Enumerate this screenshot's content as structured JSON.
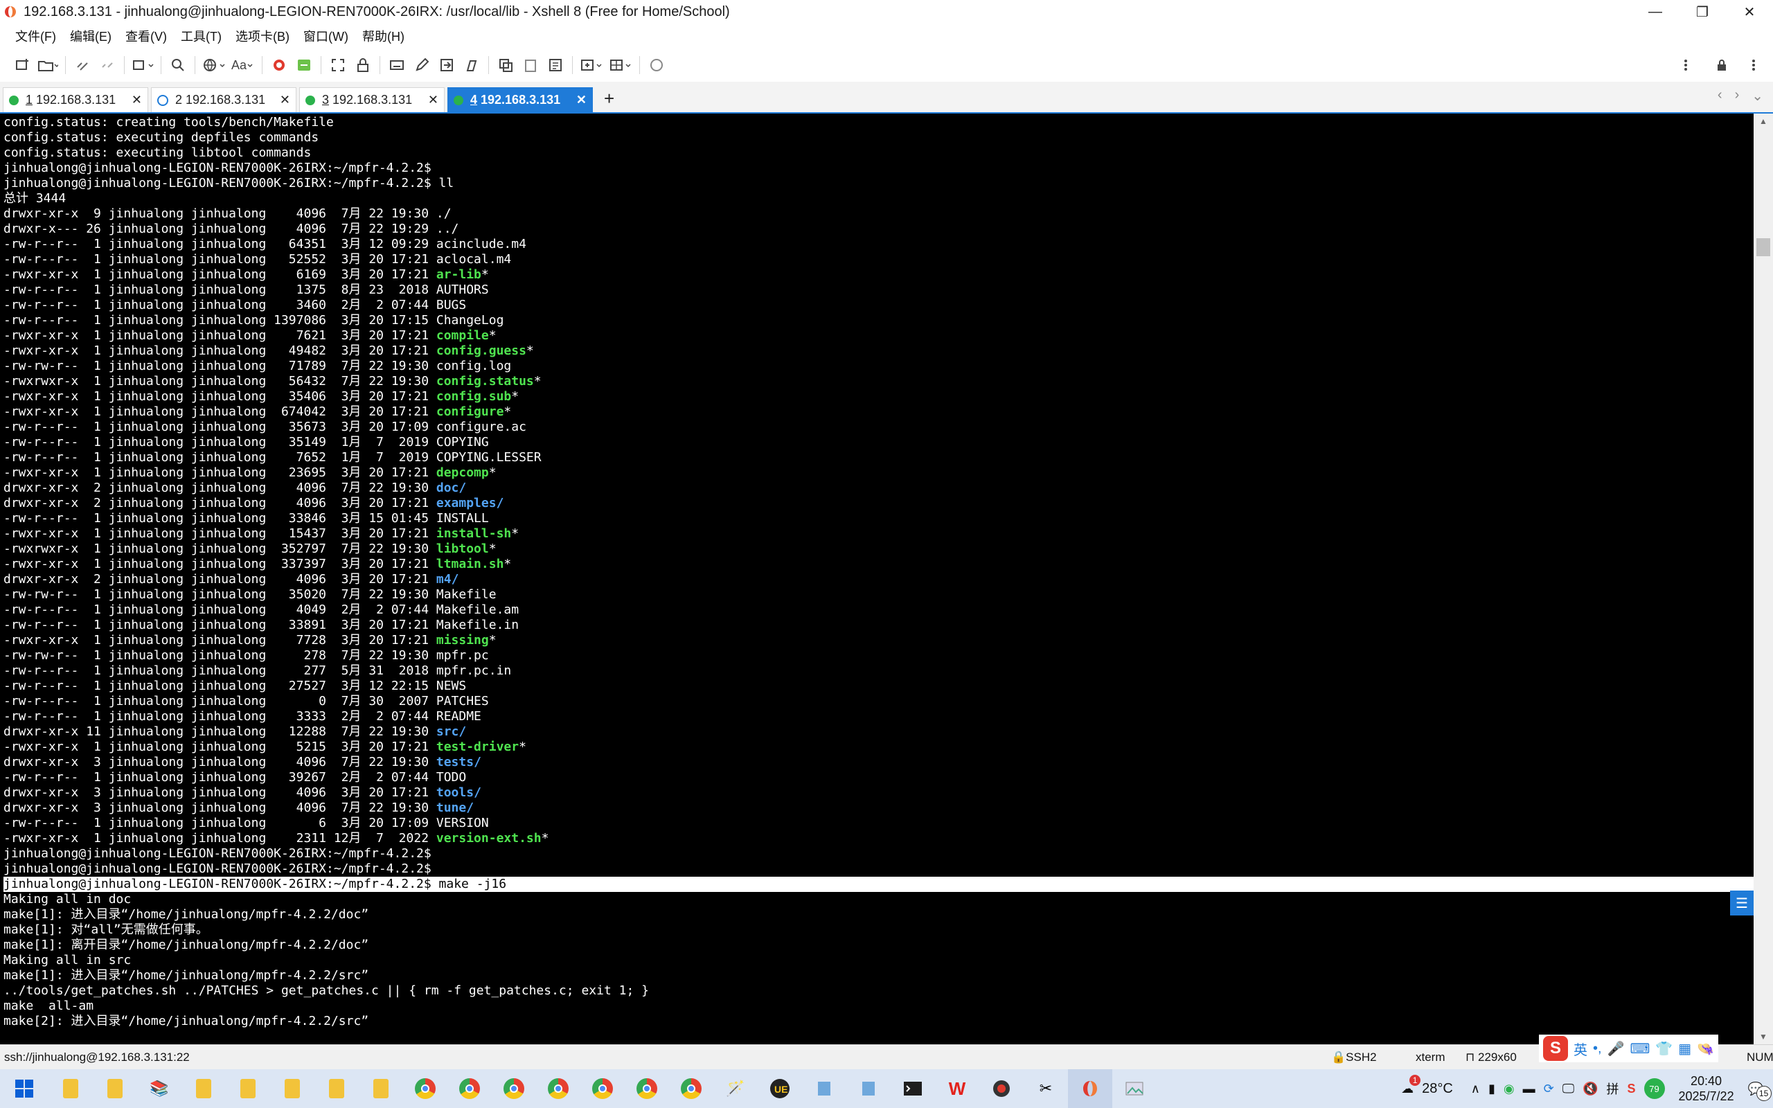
{
  "window": {
    "title": "192.168.3.131 - jinhualong@jinhualong-LEGION-REN7000K-26IRX: /usr/local/lib - Xshell 8 (Free for Home/School)",
    "minimize": "—",
    "maximize": "❐",
    "close": "✕"
  },
  "menu": [
    "文件(F)",
    "编辑(E)",
    "查看(V)",
    "工具(T)",
    "选项卡(B)",
    "窗口(W)",
    "帮助(H)"
  ],
  "tabs": [
    {
      "num": "1",
      "label": " 192.168.3.131",
      "status": "green",
      "close": "✕"
    },
    {
      "num": "2",
      "label": " 192.168.3.131",
      "status": "warning",
      "close": "✕"
    },
    {
      "num": "3",
      "label": " 192.168.3.131",
      "status": "green",
      "close": "✕"
    },
    {
      "num": "4",
      "label": " 192.168.3.131",
      "status": "green",
      "close": "✕",
      "active": true
    }
  ],
  "terminal": {
    "lines": [
      {
        "text": "config.status: creating tools/bench/Makefile"
      },
      {
        "text": "config.status: executing depfiles commands"
      },
      {
        "text": "config.status: executing libtool commands"
      },
      {
        "text": "jinhualong@jinhualong-LEGION-REN7000K-26IRX:~/mpfr-4.2.2$"
      },
      {
        "text": "jinhualong@jinhualong-LEGION-REN7000K-26IRX:~/mpfr-4.2.2$ ll"
      },
      {
        "text": "总计 3444"
      },
      {
        "prefix": "drwxr-xr-x  9 jinhualong jinhualong    4096  7月 22 19:30 ",
        "name": "./",
        "color": "plain"
      },
      {
        "prefix": "drwxr-x--- 26 jinhualong jinhualong    4096  7月 22 19:29 ",
        "name": "../",
        "color": "plain"
      },
      {
        "prefix": "-rw-r--r--  1 jinhualong jinhualong   64351  3月 12 09:29 ",
        "name": "acinclude.m4",
        "color": "plain"
      },
      {
        "prefix": "-rw-r--r--  1 jinhualong jinhualong   52552  3月 20 17:21 ",
        "name": "aclocal.m4",
        "color": "plain"
      },
      {
        "prefix": "-rwxr-xr-x  1 jinhualong jinhualong    6169  3月 20 17:21 ",
        "name": "ar-lib",
        "suffix": "*",
        "color": "green"
      },
      {
        "prefix": "-rw-r--r--  1 jinhualong jinhualong    1375  8月 23  2018 ",
        "name": "AUTHORS",
        "color": "plain"
      },
      {
        "prefix": "-rw-r--r--  1 jinhualong jinhualong    3460  2月  2 07:44 ",
        "name": "BUGS",
        "color": "plain"
      },
      {
        "prefix": "-rw-r--r--  1 jinhualong jinhualong 1397086  3月 20 17:15 ",
        "name": "ChangeLog",
        "color": "plain"
      },
      {
        "prefix": "-rwxr-xr-x  1 jinhualong jinhualong    7621  3月 20 17:21 ",
        "name": "compile",
        "suffix": "*",
        "color": "green"
      },
      {
        "prefix": "-rwxr-xr-x  1 jinhualong jinhualong   49482  3月 20 17:21 ",
        "name": "config.guess",
        "suffix": "*",
        "color": "green"
      },
      {
        "prefix": "-rw-rw-r--  1 jinhualong jinhualong   71789  7月 22 19:30 ",
        "name": "config.log",
        "color": "plain"
      },
      {
        "prefix": "-rwxrwxr-x  1 jinhualong jinhualong   56432  7月 22 19:30 ",
        "name": "config.status",
        "suffix": "*",
        "color": "green"
      },
      {
        "prefix": "-rwxr-xr-x  1 jinhualong jinhualong   35406  3月 20 17:21 ",
        "name": "config.sub",
        "suffix": "*",
        "color": "green"
      },
      {
        "prefix": "-rwxr-xr-x  1 jinhualong jinhualong  674042  3月 20 17:21 ",
        "name": "configure",
        "suffix": "*",
        "color": "green"
      },
      {
        "prefix": "-rw-r--r--  1 jinhualong jinhualong   35673  3月 20 17:09 ",
        "name": "configure.ac",
        "color": "plain"
      },
      {
        "prefix": "-rw-r--r--  1 jinhualong jinhualong   35149  1月  7  2019 ",
        "name": "COPYING",
        "color": "plain"
      },
      {
        "prefix": "-rw-r--r--  1 jinhualong jinhualong    7652  1月  7  2019 ",
        "name": "COPYING.LESSER",
        "color": "plain"
      },
      {
        "prefix": "-rwxr-xr-x  1 jinhualong jinhualong   23695  3月 20 17:21 ",
        "name": "depcomp",
        "suffix": "*",
        "color": "green"
      },
      {
        "prefix": "drwxr-xr-x  2 jinhualong jinhualong    4096  7月 22 19:30 ",
        "name": "doc",
        "suffix": "/",
        "color": "blue"
      },
      {
        "prefix": "drwxr-xr-x  2 jinhualong jinhualong    4096  3月 20 17:21 ",
        "name": "examples",
        "suffix": "/",
        "color": "blue"
      },
      {
        "prefix": "-rw-r--r--  1 jinhualong jinhualong   33846  3月 15 01:45 ",
        "name": "INSTALL",
        "color": "plain"
      },
      {
        "prefix": "-rwxr-xr-x  1 jinhualong jinhualong   15437  3月 20 17:21 ",
        "name": "install-sh",
        "suffix": "*",
        "color": "green"
      },
      {
        "prefix": "-rwxrwxr-x  1 jinhualong jinhualong  352797  7月 22 19:30 ",
        "name": "libtool",
        "suffix": "*",
        "color": "green"
      },
      {
        "prefix": "-rwxr-xr-x  1 jinhualong jinhualong  337397  3月 20 17:21 ",
        "name": "ltmain.sh",
        "suffix": "*",
        "color": "green"
      },
      {
        "prefix": "drwxr-xr-x  2 jinhualong jinhualong    4096  3月 20 17:21 ",
        "name": "m4",
        "suffix": "/",
        "color": "blue"
      },
      {
        "prefix": "-rw-rw-r--  1 jinhualong jinhualong   35020  7月 22 19:30 ",
        "name": "Makefile",
        "color": "plain"
      },
      {
        "prefix": "-rw-r--r--  1 jinhualong jinhualong    4049  2月  2 07:44 ",
        "name": "Makefile.am",
        "color": "plain"
      },
      {
        "prefix": "-rw-r--r--  1 jinhualong jinhualong   33891  3月 20 17:21 ",
        "name": "Makefile.in",
        "color": "plain"
      },
      {
        "prefix": "-rwxr-xr-x  1 jinhualong jinhualong    7728  3月 20 17:21 ",
        "name": "missing",
        "suffix": "*",
        "color": "green"
      },
      {
        "prefix": "-rw-rw-r--  1 jinhualong jinhualong     278  7月 22 19:30 ",
        "name": "mpfr.pc",
        "color": "plain"
      },
      {
        "prefix": "-rw-r--r--  1 jinhualong jinhualong     277  5月 31  2018 ",
        "name": "mpfr.pc.in",
        "color": "plain"
      },
      {
        "prefix": "-rw-r--r--  1 jinhualong jinhualong   27527  3月 12 22:15 ",
        "name": "NEWS",
        "color": "plain"
      },
      {
        "prefix": "-rw-r--r--  1 jinhualong jinhualong       0  7月 30  2007 ",
        "name": "PATCHES",
        "color": "plain"
      },
      {
        "prefix": "-rw-r--r--  1 jinhualong jinhualong    3333  2月  2 07:44 ",
        "name": "README",
        "color": "plain"
      },
      {
        "prefix": "drwxr-xr-x 11 jinhualong jinhualong   12288  7月 22 19:30 ",
        "name": "src",
        "suffix": "/",
        "color": "blue"
      },
      {
        "prefix": "-rwxr-xr-x  1 jinhualong jinhualong    5215  3月 20 17:21 ",
        "name": "test-driver",
        "suffix": "*",
        "color": "green"
      },
      {
        "prefix": "drwxr-xr-x  3 jinhualong jinhualong    4096  7月 22 19:30 ",
        "name": "tests",
        "suffix": "/",
        "color": "blue"
      },
      {
        "prefix": "-rw-r--r--  1 jinhualong jinhualong   39267  2月  2 07:44 ",
        "name": "TODO",
        "color": "plain"
      },
      {
        "prefix": "drwxr-xr-x  3 jinhualong jinhualong    4096  3月 20 17:21 ",
        "name": "tools",
        "suffix": "/",
        "color": "blue"
      },
      {
        "prefix": "drwxr-xr-x  3 jinhualong jinhualong    4096  7月 22 19:30 ",
        "name": "tune",
        "suffix": "/",
        "color": "blue"
      },
      {
        "prefix": "-rw-r--r--  1 jinhualong jinhualong       6  3月 20 17:09 ",
        "name": "VERSION",
        "color": "plain"
      },
      {
        "prefix": "-rwxr-xr-x  1 jinhualong jinhualong    2311 12月  7  2022 ",
        "name": "version-ext.sh",
        "suffix": "*",
        "color": "green"
      },
      {
        "text": "jinhualong@jinhualong-LEGION-REN7000K-26IRX:~/mpfr-4.2.2$"
      },
      {
        "text": "jinhualong@jinhualong-LEGION-REN7000K-26IRX:~/mpfr-4.2.2$"
      },
      {
        "text": "jinhualong@jinhualong-LEGION-REN7000K-26IRX:~/mpfr-4.2.2$ make -j16",
        "highlight": true
      },
      {
        "text": "Making all in doc"
      },
      {
        "text": "make[1]: 进入目录“/home/jinhualong/mpfr-4.2.2/doc”"
      },
      {
        "text": "make[1]: 对“all”无需做任何事。"
      },
      {
        "text": "make[1]: 离开目录“/home/jinhualong/mpfr-4.2.2/doc”"
      },
      {
        "text": "Making all in src"
      },
      {
        "text": "make[1]: 进入目录“/home/jinhualong/mpfr-4.2.2/src”"
      },
      {
        "text": "../tools/get_patches.sh ../PATCHES > get_patches.c || { rm -f get_patches.c; exit 1; }"
      },
      {
        "text": "make  all-am"
      },
      {
        "text": "make[2]: 进入目录“/home/jinhualong/mpfr-4.2.2/src”"
      }
    ]
  },
  "status": {
    "connection": "ssh://jinhualong@192.168.3.131:22",
    "protocol": "SSH2",
    "terminal_type": "xterm",
    "size": "229x60",
    "num": "NUM"
  },
  "ime": {
    "logo": "S",
    "lang": "英"
  },
  "taskbar": {
    "weather_temp": "28°C",
    "weather_badge": "1",
    "battery": "79",
    "time": "20:40",
    "date": "2025/7/22",
    "notifications": "15"
  },
  "colors": {
    "accent": "#1f7bd8",
    "terminal_bg": "#000000",
    "exec_green": "#4fe34f",
    "dir_blue": "#54a4f5"
  }
}
